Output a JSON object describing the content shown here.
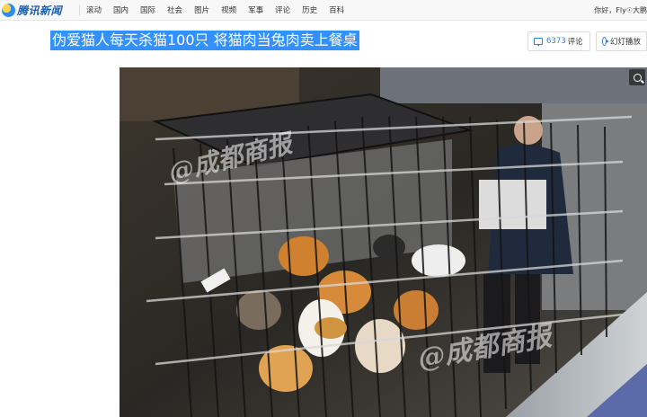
{
  "header": {
    "logo_text": "腾讯新闻",
    "nav": [
      "滚动",
      "国内",
      "国际",
      "社会",
      "图片",
      "视频",
      "军事",
      "评论",
      "历史",
      "百科"
    ],
    "greeting": "你好，Fly☉大鹏"
  },
  "article": {
    "title": "伪爱猫人每天杀猫100只 将猫肉当兔肉卖上餐桌",
    "comment_count": "6373",
    "comment_label": "评论",
    "slideshow_label": "幻灯播放"
  },
  "photo": {
    "watermark_1": "@成都商报",
    "watermark_2": "@成都商报"
  },
  "icons": [
    "logo-icon",
    "comment-icon",
    "play-icon",
    "zoom-icon"
  ],
  "colors": {
    "title_highlight": "#3390ff",
    "accent": "#3a7bd5"
  }
}
